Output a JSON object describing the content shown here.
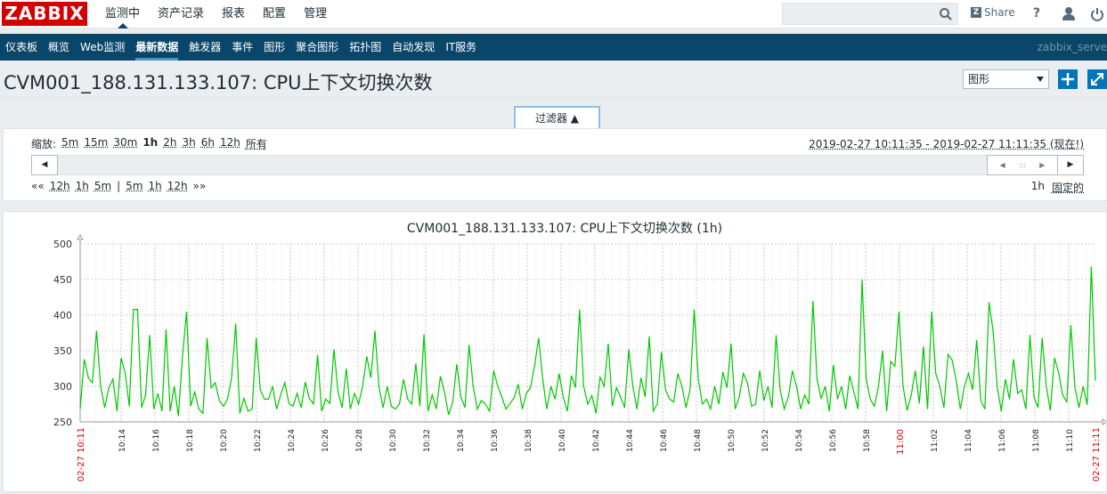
{
  "header": {
    "logo": "ZABBIX",
    "main_menu": [
      "监测中",
      "资产记录",
      "报表",
      "配置",
      "管理"
    ],
    "active_main": 0,
    "share_label": "Share",
    "help_label": "?"
  },
  "submenu": {
    "items": [
      "仪表板",
      "概览",
      "Web监测",
      "最新数据",
      "触发器",
      "事件",
      "图形",
      "聚合图形",
      "拓扑图",
      "自动发现",
      "IT服务"
    ],
    "active": 3,
    "server_name": "zabbix_serve"
  },
  "page": {
    "title": "CVM001_188.131.133.107: CPU上下文切换次数",
    "view_select": "图形"
  },
  "filter": {
    "tab_label": "过滤器 ▲",
    "zoom_label": "缩放:",
    "zoom_options": [
      "5m",
      "15m",
      "30m",
      "1h",
      "2h",
      "3h",
      "6h",
      "12h",
      "所有"
    ],
    "zoom_active": "1h",
    "date_range": "2019-02-27 10:11:35 - 2019-02-27 11:11:35 (现在!)",
    "nav_back": "««",
    "nav_back_options": [
      "12h",
      "1h",
      "5m"
    ],
    "separator": "|",
    "nav_fwd_options": [
      "5m",
      "1h",
      "12h"
    ],
    "nav_fwd": "»»",
    "period_label": "1h",
    "fixed_label": "固定的"
  },
  "chart_data": {
    "type": "line",
    "title": "CVM001_188.131.133.107: CPU上下文切换次数 (1h)",
    "ylim": [
      250,
      500
    ],
    "y_ticks": [
      250,
      300,
      350,
      400,
      450,
      500
    ],
    "x_start_label": "02-27 10:11",
    "x_end_label": "02-27 11:11",
    "x_tick_labels": [
      "10:14",
      "10:16",
      "10:18",
      "10:20",
      "10:22",
      "10:24",
      "10:26",
      "10:28",
      "10:30",
      "10:32",
      "10:34",
      "10:36",
      "10:38",
      "10:40",
      "10:42",
      "10:44",
      "10:46",
      "10:48",
      "10:50",
      "10:52",
      "10:54",
      "10:56",
      "10:58",
      "11:00",
      "11:02",
      "11:04",
      "11:06",
      "11:08",
      "11:10"
    ],
    "x_tick_minutes": [
      2.42,
      4.42,
      6.42,
      8.42,
      10.42,
      12.42,
      14.42,
      16.42,
      18.42,
      20.42,
      22.42,
      24.42,
      26.42,
      28.42,
      30.42,
      32.42,
      34.42,
      36.42,
      38.42,
      40.42,
      42.42,
      44.42,
      46.42,
      48.42,
      50.42,
      52.42,
      54.42,
      56.42,
      58.42
    ],
    "highlight_tick": "11:00",
    "grid": true,
    "series": [
      {
        "color": "#00c800",
        "values": [
          268,
          338,
          312,
          305,
          378,
          300,
          270,
          298,
          310,
          265,
          340,
          318,
          272,
          408,
          408,
          270,
          288,
          372,
          268,
          290,
          265,
          380,
          265,
          300,
          258,
          342,
          405,
          272,
          292,
          268,
          262,
          368,
          298,
          305,
          280,
          272,
          282,
          312,
          388,
          262,
          283,
          265,
          268,
          368,
          295,
          282,
          282,
          300,
          268,
          288,
          305,
          276,
          272,
          290,
          270,
          306,
          283,
          275,
          344,
          265,
          282,
          276,
          352,
          292,
          270,
          325,
          268,
          290,
          275,
          300,
          342,
          312,
          378,
          298,
          270,
          300,
          272,
          268,
          275,
          310,
          282,
          275,
          332,
          272,
          373,
          265,
          288,
          268,
          314,
          292,
          260,
          277,
          331,
          285,
          270,
          358,
          300,
          268,
          280,
          275,
          265,
          322,
          300,
          285,
          268,
          276,
          284,
          303,
          268,
          290,
          298,
          328,
          368,
          310,
          268,
          300,
          282,
          318,
          285,
          265,
          315,
          298,
          408,
          300,
          275,
          287,
          262,
          313,
          300,
          360,
          272,
          298,
          285,
          270,
          352,
          300,
          268,
          312,
          285,
          370,
          265,
          275,
          348,
          295,
          282,
          278,
          318,
          300,
          270,
          296,
          408,
          310,
          275,
          282,
          268,
          300,
          275,
          320,
          298,
          360,
          268,
          285,
          318,
          305,
          272,
          275,
          322,
          280,
          300,
          270,
          372,
          295,
          268,
          285,
          322,
          300,
          268,
          288,
          275,
          420,
          310,
          283,
          300,
          265,
          330,
          282,
          300,
          268,
          315,
          292,
          268,
          450,
          310,
          282,
          272,
          300,
          350,
          265,
          335,
          328,
          405,
          300,
          266,
          287,
          322,
          276,
          356,
          268,
          405,
          318,
          300,
          270,
          345,
          337,
          308,
          268,
          300,
          318,
          295,
          365,
          280,
          268,
          418,
          378,
          300,
          265,
          310,
          282,
          338,
          290,
          295,
          268,
          372,
          285,
          270,
          368,
          300,
          266,
          340,
          320,
          288,
          278,
          386,
          298,
          270,
          300,
          274,
          468,
          308
        ]
      }
    ]
  }
}
